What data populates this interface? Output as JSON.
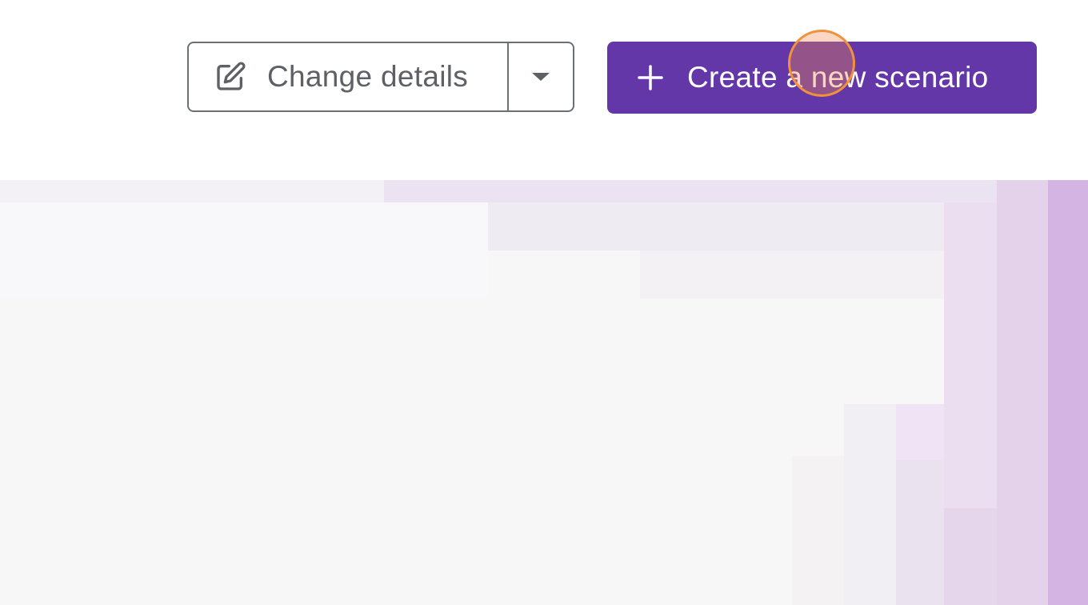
{
  "toolbar": {
    "change_details": {
      "label": "Change details",
      "icon": "edit-icon",
      "menu_icon": "caret-down-icon"
    },
    "create_scenario": {
      "label": "Create a new scenario",
      "icon": "plus-icon"
    }
  },
  "colors": {
    "primary": "#6437a8",
    "outline": "#6b7075",
    "text_muted": "#5d6166",
    "click_indicator": "#f0913c",
    "content_bg": "#f7f7f8",
    "accent_tint": "#d3b4e2"
  }
}
